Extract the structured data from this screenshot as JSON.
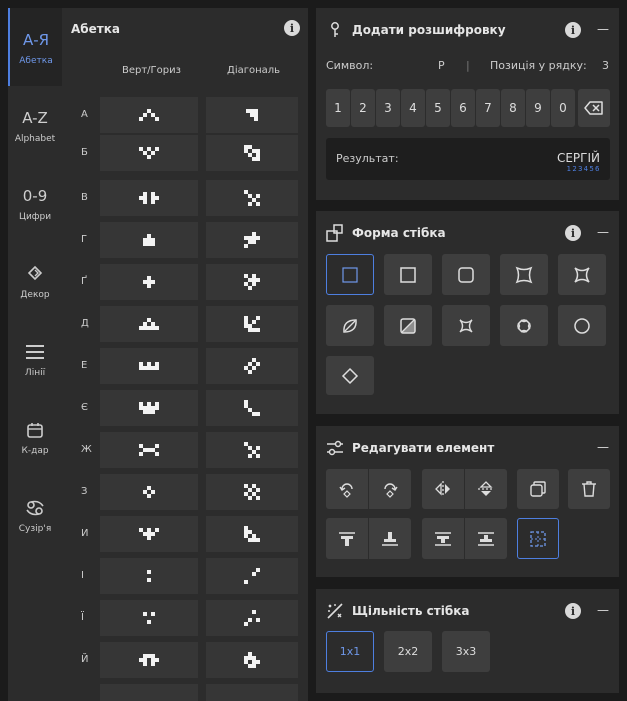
{
  "sidebar": {
    "items": [
      {
        "glyph": "А-Я",
        "label": "Абетка",
        "active": true
      },
      {
        "glyph": "A-Z",
        "label": "Alphabet",
        "active": false
      },
      {
        "glyph": "0-9",
        "label": "Цифри",
        "active": false
      },
      {
        "glyph": "",
        "label": "Декор",
        "active": false
      },
      {
        "glyph": "",
        "label": "Лінії",
        "active": false
      },
      {
        "glyph": "",
        "label": "К-дар",
        "active": false
      },
      {
        "glyph": "",
        "label": "Сузір'я",
        "active": false
      }
    ]
  },
  "alphabet": {
    "title": "Абетка",
    "col1": "Верт/Гориз",
    "col2": "Діагональ",
    "letters": [
      "А",
      "Б",
      "В",
      "Г",
      "Ґ",
      "Д",
      "Е",
      "Є",
      "Ж",
      "З",
      "И",
      "І",
      "Ї",
      "Й"
    ]
  },
  "decode": {
    "title": "Додати розшифровку",
    "symbol_label": "Символ:",
    "symbol_value": "Р",
    "separator": "|",
    "position_label": "Позиція у рядку:",
    "position_value": "3",
    "keys": [
      "1",
      "2",
      "3",
      "4",
      "5",
      "6",
      "7",
      "8",
      "9",
      "0"
    ],
    "result_label": "Результат:",
    "result_value": "СЕРГІЙ",
    "result_positions": "1 2 3 4 5 6"
  },
  "stitch_shape": {
    "title": "Форма стібка"
  },
  "edit": {
    "title": "Редагувати елемент"
  },
  "density": {
    "title": "Щільність стібка",
    "options": [
      "1x1",
      "2x2",
      "3x3"
    ]
  },
  "info_glyph": "i",
  "collapse_glyph": "—"
}
